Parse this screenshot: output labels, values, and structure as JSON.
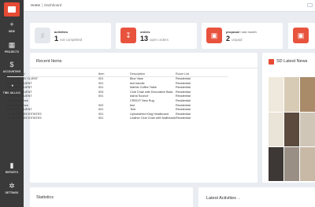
{
  "sidebar": {
    "items": [
      {
        "icon": "plus-icon",
        "glyph": "+",
        "label": "NEW"
      },
      {
        "icon": "building-icon",
        "glyph": "▦",
        "label": "PROJECTS"
      },
      {
        "icon": "dollar-icon",
        "glyph": "$",
        "label": "ACCOUNTING"
      },
      {
        "icon": "clock-icon",
        "glyph": "◔",
        "label": "TIME BILLING"
      },
      {
        "icon": "chart-icon",
        "glyph": "▮",
        "label": "REPORTS"
      },
      {
        "icon": "gear-icon",
        "glyph": "✲",
        "label": "SETTINGS"
      }
    ]
  },
  "header": {
    "breadcrumb": [
      "Home",
      "Dashboard"
    ]
  },
  "stats": [
    {
      "icon": "bell-icon",
      "title": "activities",
      "subtitle": "",
      "value": "1",
      "label": "not completed",
      "style": "grey"
    },
    {
      "icon": "download-icon",
      "title": "orders",
      "subtitle": "",
      "value": "13",
      "label": "open orders",
      "style": "red"
    },
    {
      "icon": "briefcase-icon",
      "title": "proposal",
      "subtitle": "/ last month",
      "value": "2",
      "label": "unpaid",
      "style": "red"
    },
    {
      "icon": "briefcase-icon",
      "title": "",
      "subtitle": "",
      "value": "",
      "label": "",
      "style": "red"
    }
  ],
  "recent": {
    "title": "Recent Items",
    "columns": [
      "Client/Project",
      "Item",
      "Description",
      "Room List"
    ],
    "rows": [
      [
        "PELICAN BAY CLIENT",
        "001",
        "Blue Vase",
        "Residential"
      ],
      [
        "NAPLES1 CLIENT",
        "001",
        "test handle",
        "Residential"
      ],
      [
        "NAPLES1 CLIENT",
        "001",
        "Marble Coffee Table",
        "Residential"
      ],
      [
        "NAPLES1 CLIENT",
        "004",
        "Club Chair with Decorative Back",
        "Residential"
      ],
      [
        "NAPLES1 CLIENT",
        "001",
        "Astral Sconce",
        "Residential"
      ],
      [
        "Reid Residence",
        "",
        "CREDIT New Rug",
        "Residential"
      ],
      [
        "Reid Residence",
        "002",
        "test",
        "Residential"
      ],
      [
        "NAPLES1 CLIENT",
        "001",
        "Test",
        "Residential"
      ],
      [
        "QUAILWOODS ESTATES",
        "001",
        "Upholstered King Headboard",
        "Residential"
      ],
      [
        "QUAILWOODS ESTATES",
        "001",
        "Leather Club Chair with Nailheads",
        "Residential"
      ]
    ]
  },
  "news": {
    "title": "SD Latest News"
  },
  "statistics": {
    "title": "Statistics"
  },
  "latest": {
    "title": "Latest Activities",
    "chevron": "⌄"
  }
}
